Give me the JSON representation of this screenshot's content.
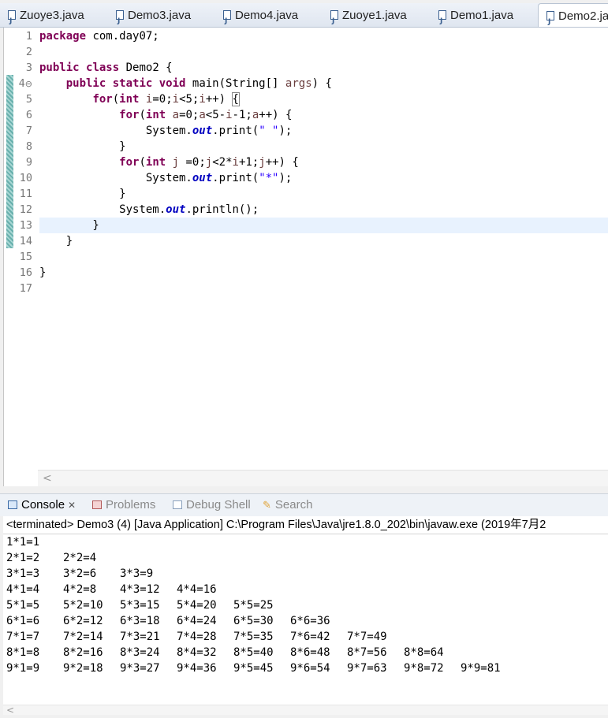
{
  "editor_tabs": [
    {
      "label": "Zuoye3.java",
      "active": false
    },
    {
      "label": "Demo3.java",
      "active": false
    },
    {
      "label": "Demo4.java",
      "active": false
    },
    {
      "label": "Zuoye1.java",
      "active": false
    },
    {
      "label": "Demo1.java",
      "active": false
    },
    {
      "label": "Demo2.ja",
      "active": true
    }
  ],
  "editor": {
    "fold_marker": "⊖",
    "line_numbers": [
      "1",
      "2",
      "3",
      "4",
      "5",
      "6",
      "7",
      "8",
      "9",
      "10",
      "11",
      "12",
      "13",
      "14",
      "15",
      "16",
      "17"
    ],
    "lines": [
      [
        {
          "k": "kw",
          "t": "package"
        },
        {
          "t": " com.day07;"
        }
      ],
      [],
      [
        {
          "k": "kw",
          "t": "public"
        },
        {
          "t": " "
        },
        {
          "k": "kw",
          "t": "class"
        },
        {
          "t": " Demo2 {"
        }
      ],
      [
        {
          "t": "    "
        },
        {
          "k": "kw",
          "t": "public"
        },
        {
          "t": " "
        },
        {
          "k": "kw",
          "t": "static"
        },
        {
          "t": " "
        },
        {
          "k": "kw",
          "t": "void"
        },
        {
          "t": " main(String[] "
        },
        {
          "k": "vr",
          "t": "args"
        },
        {
          "t": ") {"
        }
      ],
      [
        {
          "t": "        "
        },
        {
          "k": "kw",
          "t": "for"
        },
        {
          "t": "("
        },
        {
          "k": "kw",
          "t": "int"
        },
        {
          "t": " "
        },
        {
          "k": "vr",
          "t": "i"
        },
        {
          "t": "=0;"
        },
        {
          "k": "vr",
          "t": "i"
        },
        {
          "t": "<5;"
        },
        {
          "k": "vr",
          "t": "i"
        },
        {
          "t": "++) "
        },
        {
          "k": "bm",
          "t": "{"
        }
      ],
      [
        {
          "t": "            "
        },
        {
          "k": "kw",
          "t": "for"
        },
        {
          "t": "("
        },
        {
          "k": "kw",
          "t": "int"
        },
        {
          "t": " "
        },
        {
          "k": "vr",
          "t": "a"
        },
        {
          "t": "=0;"
        },
        {
          "k": "vr",
          "t": "a"
        },
        {
          "t": "<5-"
        },
        {
          "k": "vr",
          "t": "i"
        },
        {
          "t": "-1;"
        },
        {
          "k": "vr",
          "t": "a"
        },
        {
          "t": "++) {"
        }
      ],
      [
        {
          "t": "                System."
        },
        {
          "k": "fl",
          "t": "out"
        },
        {
          "t": ".print("
        },
        {
          "k": "st",
          "t": "\" \""
        },
        {
          "t": ");"
        }
      ],
      [
        {
          "t": "            }"
        }
      ],
      [
        {
          "t": "            "
        },
        {
          "k": "kw",
          "t": "for"
        },
        {
          "t": "("
        },
        {
          "k": "kw",
          "t": "int"
        },
        {
          "t": " "
        },
        {
          "k": "vr",
          "t": "j"
        },
        {
          "t": " =0;"
        },
        {
          "k": "vr",
          "t": "j"
        },
        {
          "t": "<2*"
        },
        {
          "k": "vr",
          "t": "i"
        },
        {
          "t": "+1;"
        },
        {
          "k": "vr",
          "t": "j"
        },
        {
          "t": "++) {"
        }
      ],
      [
        {
          "t": "                System."
        },
        {
          "k": "fl",
          "t": "out"
        },
        {
          "t": ".print("
        },
        {
          "k": "st",
          "t": "\"*\""
        },
        {
          "t": ");"
        }
      ],
      [
        {
          "t": "            }"
        }
      ],
      [
        {
          "t": "            System."
        },
        {
          "k": "fl",
          "t": "out"
        },
        {
          "t": ".println();"
        }
      ],
      [
        {
          "t": "        }"
        }
      ],
      [
        {
          "t": "    }"
        }
      ],
      [],
      [
        {
          "t": "}"
        }
      ],
      []
    ],
    "scroll_left_glyph": "<"
  },
  "console_tabs": [
    {
      "label": "Console",
      "active": true,
      "icon": "console-icon",
      "close": "✕"
    },
    {
      "label": "Problems",
      "active": false,
      "icon": "problems-icon"
    },
    {
      "label": "Debug Shell",
      "active": false,
      "icon": "debug-shell-icon"
    },
    {
      "label": "Search",
      "active": false,
      "icon": "search-icon",
      "glyph": "✎"
    }
  ],
  "console": {
    "header": "<terminated> Demo3 (4) [Java Application] C:\\Program Files\\Java\\jre1.8.0_202\\bin\\javaw.exe (2019年7月2",
    "output": [
      [
        "1*1=1"
      ],
      [
        "2*1=2",
        "2*2=4"
      ],
      [
        "3*1=3",
        "3*2=6",
        "3*3=9"
      ],
      [
        "4*1=4",
        "4*2=8",
        "4*3=12",
        "4*4=16"
      ],
      [
        "5*1=5",
        "5*2=10",
        "5*3=15",
        "5*4=20",
        "5*5=25"
      ],
      [
        "6*1=6",
        "6*2=12",
        "6*3=18",
        "6*4=24",
        "6*5=30",
        "6*6=36"
      ],
      [
        "7*1=7",
        "7*2=14",
        "7*3=21",
        "7*4=28",
        "7*5=35",
        "7*6=42",
        "7*7=49"
      ],
      [
        "8*1=8",
        "8*2=16",
        "8*3=24",
        "8*4=32",
        "8*5=40",
        "8*6=48",
        "8*7=56",
        "8*8=64"
      ],
      [
        "9*1=9",
        "9*2=18",
        "9*3=27",
        "9*4=36",
        "9*5=45",
        "9*6=54",
        "9*7=63",
        "9*8=72",
        "9*9=81"
      ]
    ],
    "scroll_left_glyph": "<"
  }
}
